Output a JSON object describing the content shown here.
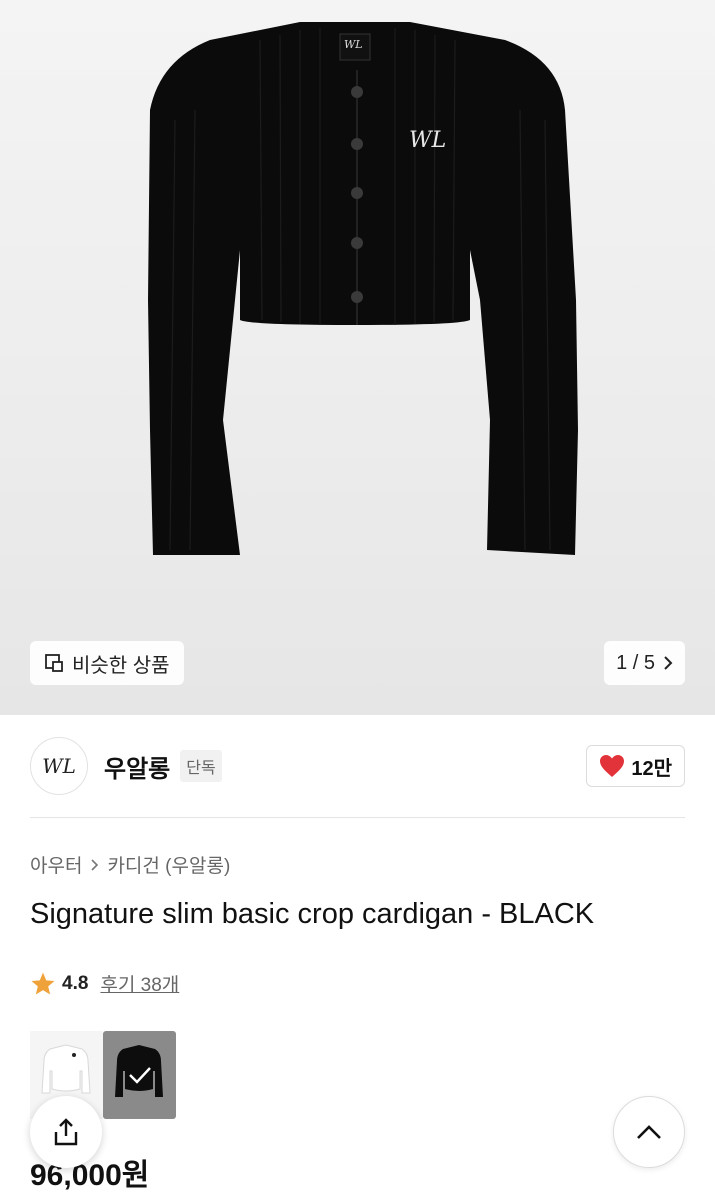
{
  "hero": {
    "logo_text": "WL",
    "similar_label": "비슷한 상품",
    "page_counter": "1 / 5"
  },
  "brand": {
    "logo_text": "WL",
    "name": "우알롱",
    "tag": "단독",
    "likes": "12만"
  },
  "breadcrumb": {
    "category": "아우터",
    "subcategory": "카디건 (우알롱)"
  },
  "product": {
    "title": "Signature slim basic crop cardigan - BLACK",
    "rating": "4.8",
    "reviews_label": "후기 38개",
    "price": "96,000원"
  },
  "color_options": [
    {
      "name": "white",
      "selected": false
    },
    {
      "name": "black",
      "selected": true
    }
  ],
  "colors": {
    "heart": "#e3333a",
    "star": "#f0a23a",
    "text_primary": "#111111",
    "text_secondary": "#666666"
  },
  "icons": [
    "similar-items-icon",
    "chevron-right-icon",
    "heart-icon",
    "star-icon",
    "check-icon",
    "share-icon",
    "chevron-up-icon"
  ]
}
